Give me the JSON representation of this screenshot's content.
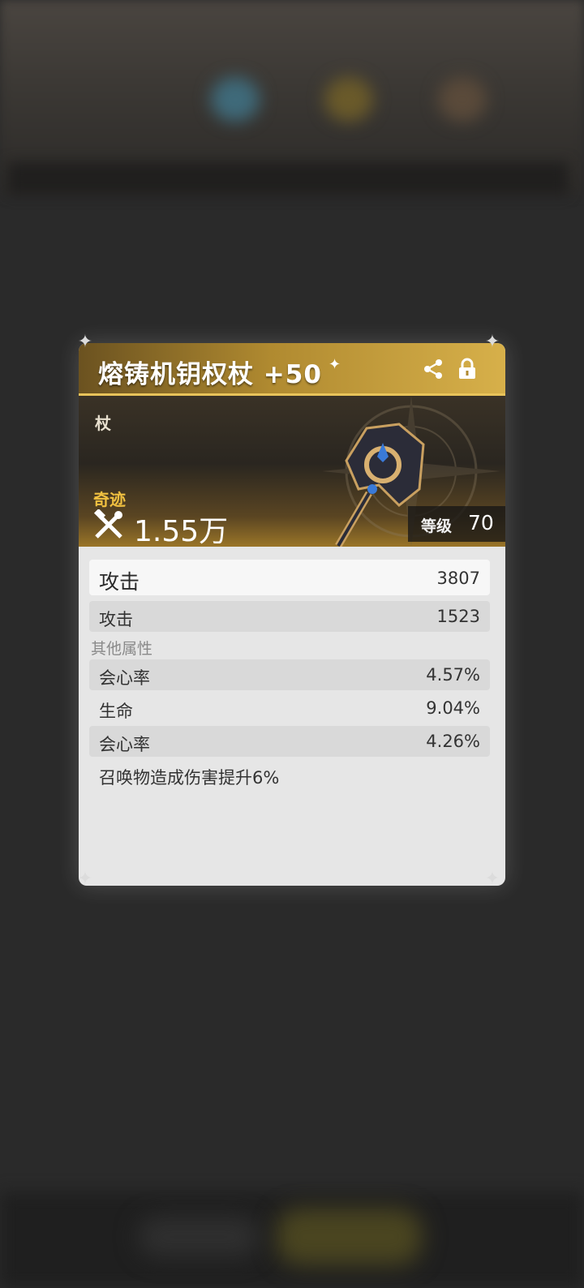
{
  "weapon": {
    "name": "熔铸机钥权杖 +50",
    "type": "杖",
    "rarity": "奇迹",
    "power": "1.55万",
    "level_label": "等级",
    "level": "70"
  },
  "stats": {
    "main": {
      "label": "攻击",
      "value": "3807"
    },
    "base": {
      "label": "攻击",
      "value": "1523"
    },
    "other_header": "其他属性",
    "other": [
      {
        "label": "会心率",
        "value": "4.57%"
      },
      {
        "label": "生命",
        "value": "9.04%"
      },
      {
        "label": "会心率",
        "value": "4.26%"
      }
    ],
    "effect": "召唤物造成伤害提升6%"
  },
  "icons": {
    "share": "share-icon",
    "lock": "lock-icon",
    "power": "crossed-tools-icon"
  },
  "colors": {
    "gold": "#d7b04a",
    "rarity": "#f0c040",
    "card": "#e6e6e6",
    "background": "#2a2a2a"
  }
}
